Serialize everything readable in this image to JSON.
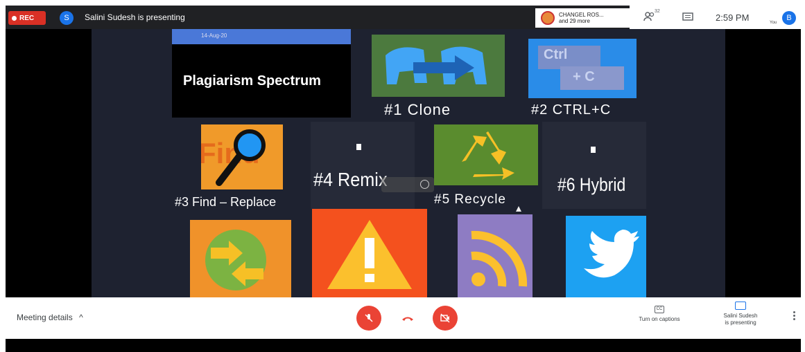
{
  "topbar": {
    "rec_label": "REC",
    "presenter_initial": "S",
    "presenter_text": "Salini Sudesh is presenting",
    "participant_name": "CHANGEL ROS...",
    "participant_more": "and 29 more",
    "people_count": "32",
    "time": "2:59 PM",
    "you_initial": "B",
    "you_label": "You"
  },
  "slide": {
    "date": "14-Aug-20",
    "title": "Plagiarism Spectrum",
    "label_1": "#1  Clone",
    "label_2": "#2  CTRL+C",
    "label_3": "#3  Find – Replace",
    "label_4": "#4 Remix",
    "label_5": "#5  Recycle",
    "label_6": "#6 Hybrid",
    "ctrl_text_1": "Ctrl",
    "ctrl_text_2": "+ C",
    "find_text": "Find"
  },
  "bottombar": {
    "meeting_details": "Meeting details",
    "captions_label": "Turn on captions",
    "presenting_line1": "Salini Sudesh",
    "presenting_line2": "is presenting"
  },
  "colors": {
    "rec_red": "#d93025",
    "google_blue": "#1a73e8",
    "control_red": "#ea4335"
  }
}
